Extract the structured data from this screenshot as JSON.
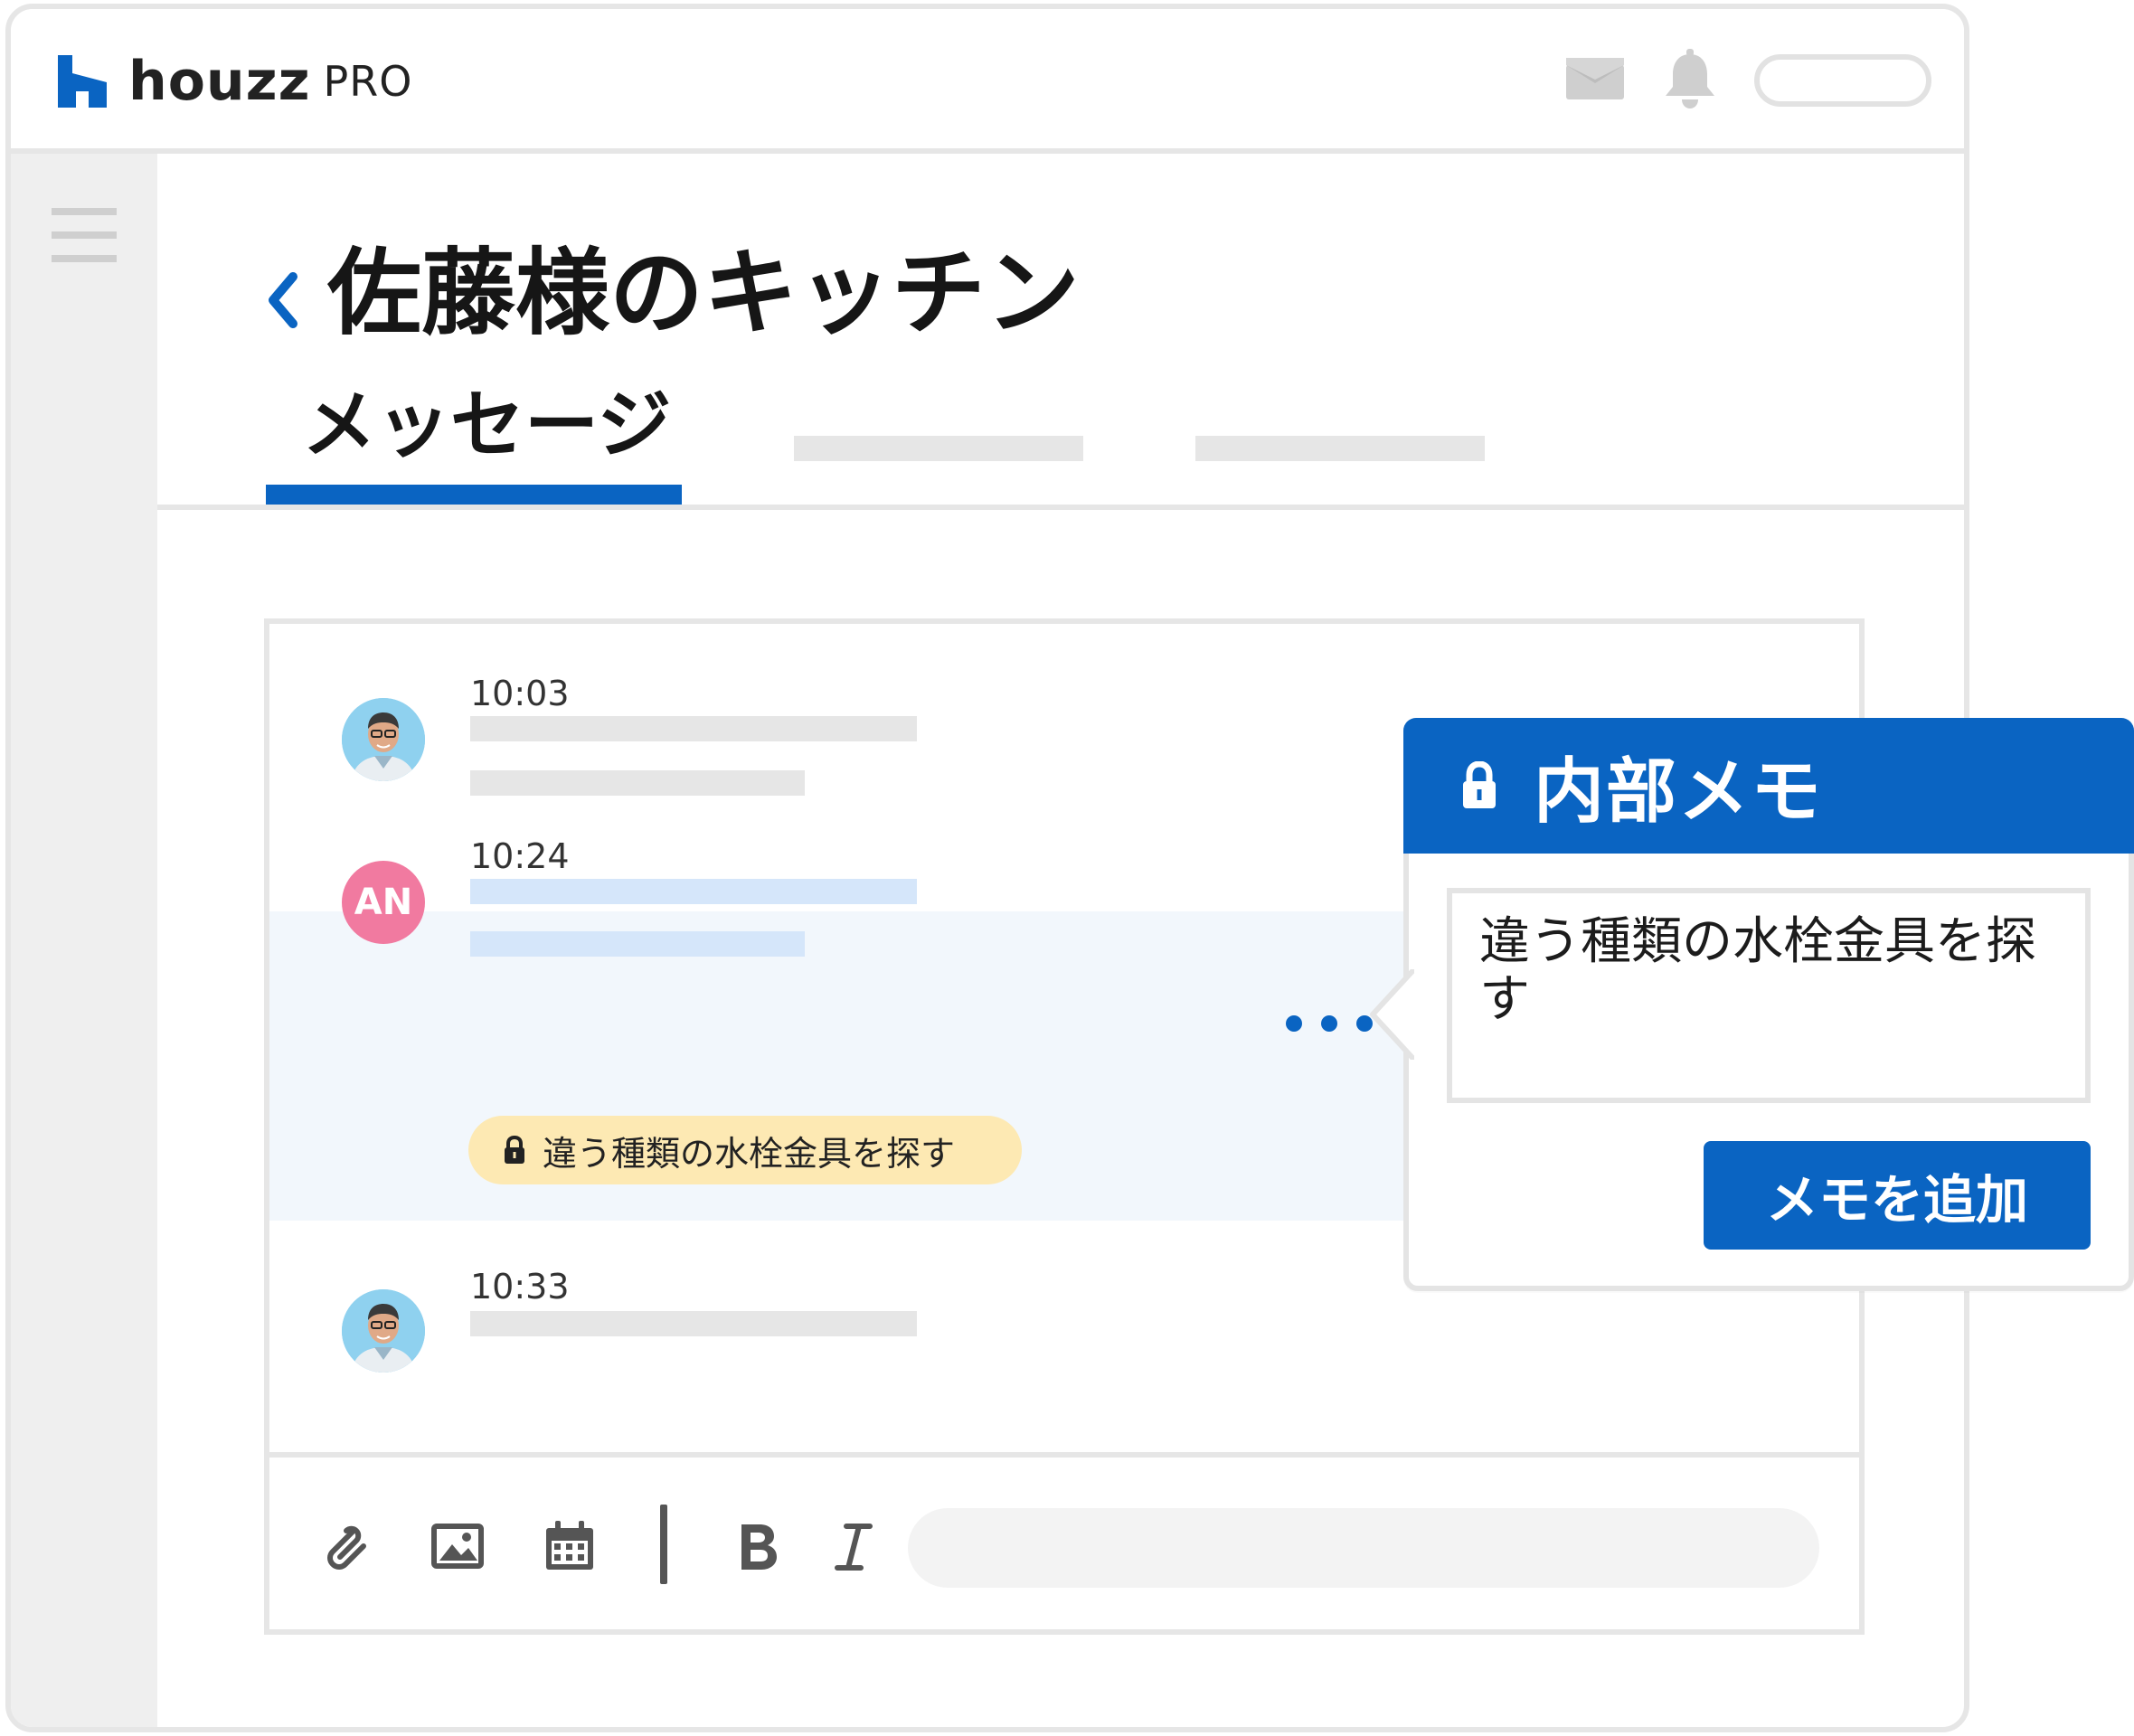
{
  "app": {
    "brand": "houzz",
    "brand_suffix": "PRO"
  },
  "header": {
    "page_title": "佐藤様のキッチン",
    "tabs": [
      {
        "label": "メッセージ",
        "active": true
      }
    ]
  },
  "messages": [
    {
      "time": "10:03",
      "avatar": "person-photo"
    },
    {
      "time": "10:24",
      "avatar_initials": "AN",
      "note": "違う種類の水栓金具を探す",
      "highlighted": true
    },
    {
      "time": "10:33",
      "avatar": "person-photo"
    }
  ],
  "toolbar": {
    "icons": [
      "paperclip-icon",
      "image-icon",
      "calendar-icon",
      "bold-icon",
      "italic-icon"
    ]
  },
  "memo": {
    "title": "内部メモ",
    "text": "違う種類の水栓金具を探す",
    "add_button": "メモを追加"
  },
  "colors": {
    "accent": "#0a64c2",
    "note_bg": "#fde9b3",
    "avatar_an": "#f17aa0",
    "avatar_photo_bg": "#8fd1ef",
    "highlight_row": "#f2f7fc"
  }
}
